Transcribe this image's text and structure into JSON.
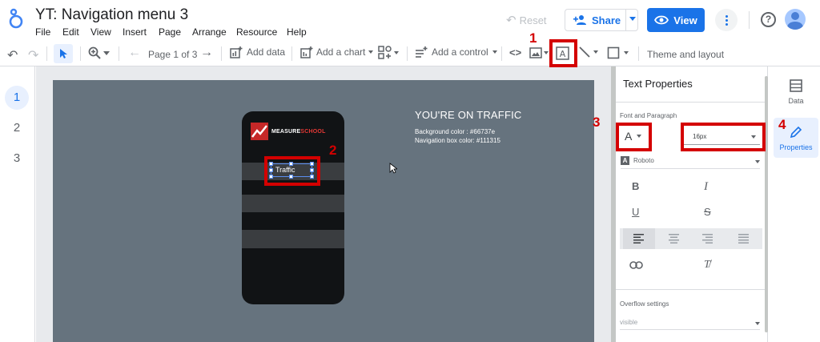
{
  "app": {
    "title": "YT: Navigation menu 3",
    "menu": [
      "File",
      "Edit",
      "View",
      "Insert",
      "Page",
      "Arrange",
      "Resource",
      "Help"
    ],
    "reset_label": "Reset",
    "share_label": "Share",
    "view_label": "View"
  },
  "toolbar": {
    "page_indicator": "Page 1 of 3",
    "add_data_label": "Add data",
    "add_chart_label": "Add a chart",
    "add_control_label": "Add a control",
    "theme_label": "Theme and layout"
  },
  "pages": [
    "1",
    "2",
    "3"
  ],
  "canvas": {
    "bg_color": "#66737e",
    "nav_box_color": "#111315",
    "logo_text_a": "MEASURE",
    "logo_text_b": "SCHOOL",
    "selected_text": "Traffic",
    "heading": "YOU'RE ON TRAFFIC",
    "info_line1": "Background color : #66737e",
    "info_line2": "Navigation box color: #111315"
  },
  "properties": {
    "title": "Text Properties",
    "section_font": "Font and Paragraph",
    "font_color_label": "A",
    "font_size": "16px",
    "font_family": "Roboto",
    "overflow_label": "Overflow settings",
    "overflow_value": "visible"
  },
  "side_tabs": {
    "data_label": "Data",
    "properties_label": "Properties"
  },
  "annotations": [
    "1",
    "2",
    "3",
    "4"
  ],
  "colors": {
    "accent": "#1a73e8",
    "highlight": "#d40000",
    "canvas_bg": "#66737e",
    "nav_bg": "#111315",
    "row_gray": "#3a3d40"
  }
}
